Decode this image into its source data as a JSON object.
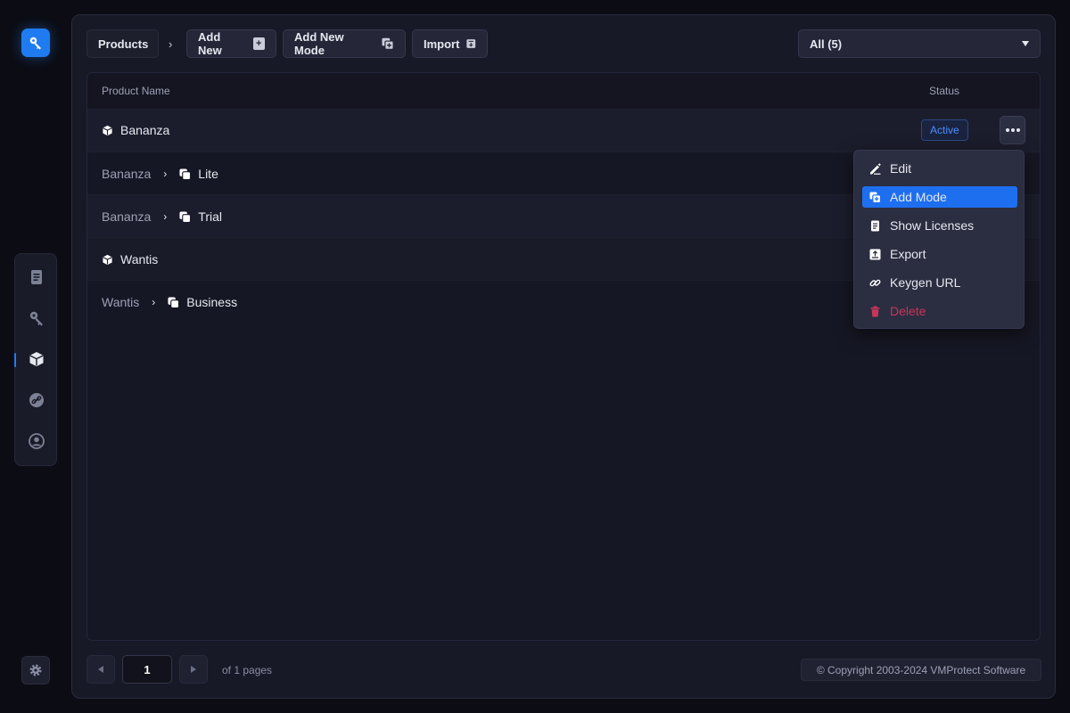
{
  "toolbar": {
    "breadcrumb": "Products",
    "add_new_label": "Add New",
    "add_new_mode_label": "Add New Mode",
    "import_label": "Import",
    "filter_value": "All (5)"
  },
  "table": {
    "columns": {
      "name": "Product Name",
      "status": "Status"
    },
    "rows": [
      {
        "type": "product",
        "name": "Bananza",
        "status": "Active"
      },
      {
        "type": "mode",
        "parent": "Bananza",
        "name": "Lite"
      },
      {
        "type": "mode",
        "parent": "Bananza",
        "name": "Trial"
      },
      {
        "type": "product",
        "name": "Wantis"
      },
      {
        "type": "mode",
        "parent": "Wantis",
        "name": "Business"
      }
    ]
  },
  "context_menu": {
    "items": [
      {
        "label": "Edit",
        "icon": "pencil-icon"
      },
      {
        "label": "Add Mode",
        "icon": "add-mode-icon",
        "highlighted": true
      },
      {
        "label": "Show Licenses",
        "icon": "document-icon"
      },
      {
        "label": "Export",
        "icon": "export-icon"
      },
      {
        "label": "Keygen URL",
        "icon": "link-icon"
      },
      {
        "label": "Delete",
        "icon": "trash-icon",
        "danger": true
      }
    ]
  },
  "pagination": {
    "current_page": "1",
    "total_label": "of 1 pages"
  },
  "footer": {
    "copyright": "© Copyright 2003-2024 VMProtect Software"
  },
  "nav": {
    "items": [
      "documents-icon",
      "key-icon",
      "box-icon",
      "link-icon",
      "user-icon"
    ],
    "active": "box-icon"
  },
  "colors": {
    "accent": "#1f7cf0",
    "active_badge": "#4d8cff",
    "danger": "#c9365a"
  }
}
